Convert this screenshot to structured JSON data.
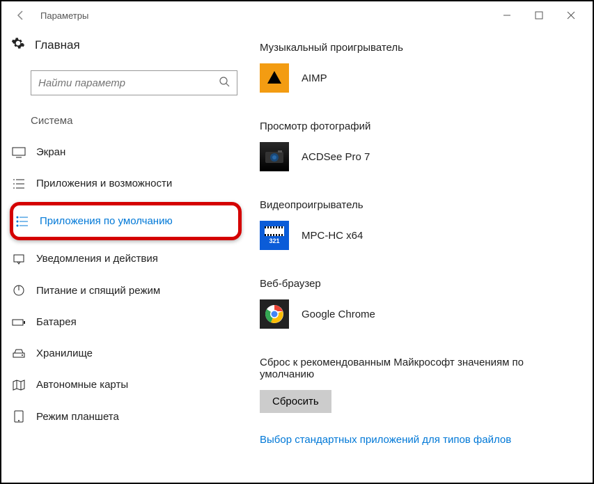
{
  "window": {
    "title": "Параметры"
  },
  "sidebar": {
    "home": "Главная",
    "search_placeholder": "Найти параметр",
    "section": "Система",
    "items": [
      {
        "label": "Экран"
      },
      {
        "label": "Приложения и возможности"
      },
      {
        "label": "Приложения по умолчанию"
      },
      {
        "label": "Уведомления и действия"
      },
      {
        "label": "Питание и спящий режим"
      },
      {
        "label": "Батарея"
      },
      {
        "label": "Хранилище"
      },
      {
        "label": "Автономные карты"
      },
      {
        "label": "Режим планшета"
      }
    ]
  },
  "main": {
    "categories": [
      {
        "title": "Музыкальный проигрыватель",
        "app": "AIMP"
      },
      {
        "title": "Просмотр фотографий",
        "app": "ACDSee Pro 7"
      },
      {
        "title": "Видеопроигрыватель",
        "app": "MPC-HC x64"
      },
      {
        "title": "Веб-браузер",
        "app": "Google Chrome"
      }
    ],
    "reset_title": "Сброс к рекомендованным Майкрософт значениям по умолчанию",
    "reset_btn": "Сбросить",
    "link": "Выбор стандартных приложений для типов файлов"
  }
}
